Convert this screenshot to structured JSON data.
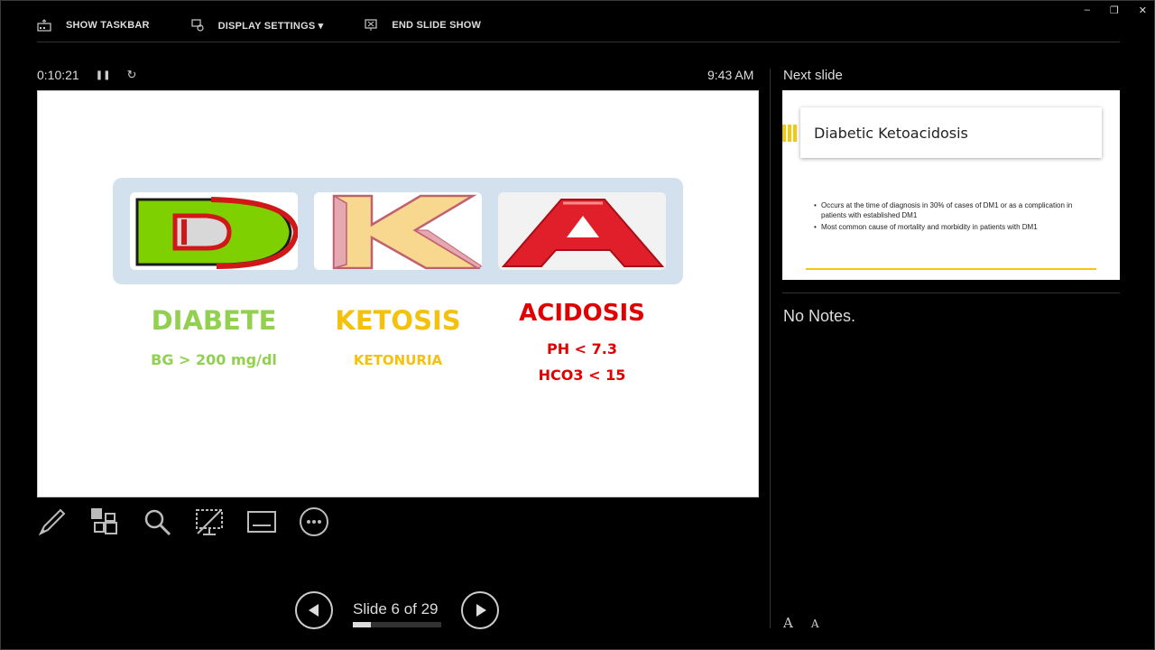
{
  "toolbar": {
    "show_taskbar": "SHOW TASKBAR",
    "display_settings": "DISPLAY SETTINGS ▾",
    "end_slide_show": "END SLIDE SHOW"
  },
  "window_controls": {
    "minimize": "–",
    "restore": "❐",
    "close": "✕"
  },
  "timer": {
    "elapsed": "0:10:21",
    "pause_icon": "❚❚",
    "reset_icon": "↻"
  },
  "clock": "9:43 AM",
  "current_slide": {
    "letters": [
      "D",
      "K",
      "A"
    ],
    "columns": [
      {
        "heading": "DIABETE",
        "lines": [
          "BG > 200 mg/dl"
        ],
        "color": "#92d050"
      },
      {
        "heading": "KETOSIS",
        "lines": [
          "KETONURIA"
        ],
        "color": "#f4c20d"
      },
      {
        "heading": "ACIDOSIS",
        "lines": [
          "PH < 7.3",
          "HCO3 < 15"
        ],
        "color": "#e00000"
      }
    ]
  },
  "next_slide": {
    "label": "Next slide",
    "title": "Diabetic Ketoacidosis",
    "bullets": [
      "Occurs at the time of diagnosis in 30% of cases of DM1 or as a complication in patients with established DM1",
      "Most common cause of mortality and morbidity in patients with DM1"
    ],
    "accent": "#f2c811"
  },
  "notes": "No Notes.",
  "tools": [
    "pen-icon",
    "see-all-slides-icon",
    "zoom-icon",
    "black-screen-icon",
    "subtitles-icon",
    "more-options-icon"
  ],
  "navigation": {
    "counter": "Slide 6 of 29",
    "current": 6,
    "total": 29
  },
  "font_size": {
    "increase": "A",
    "decrease": "A"
  }
}
